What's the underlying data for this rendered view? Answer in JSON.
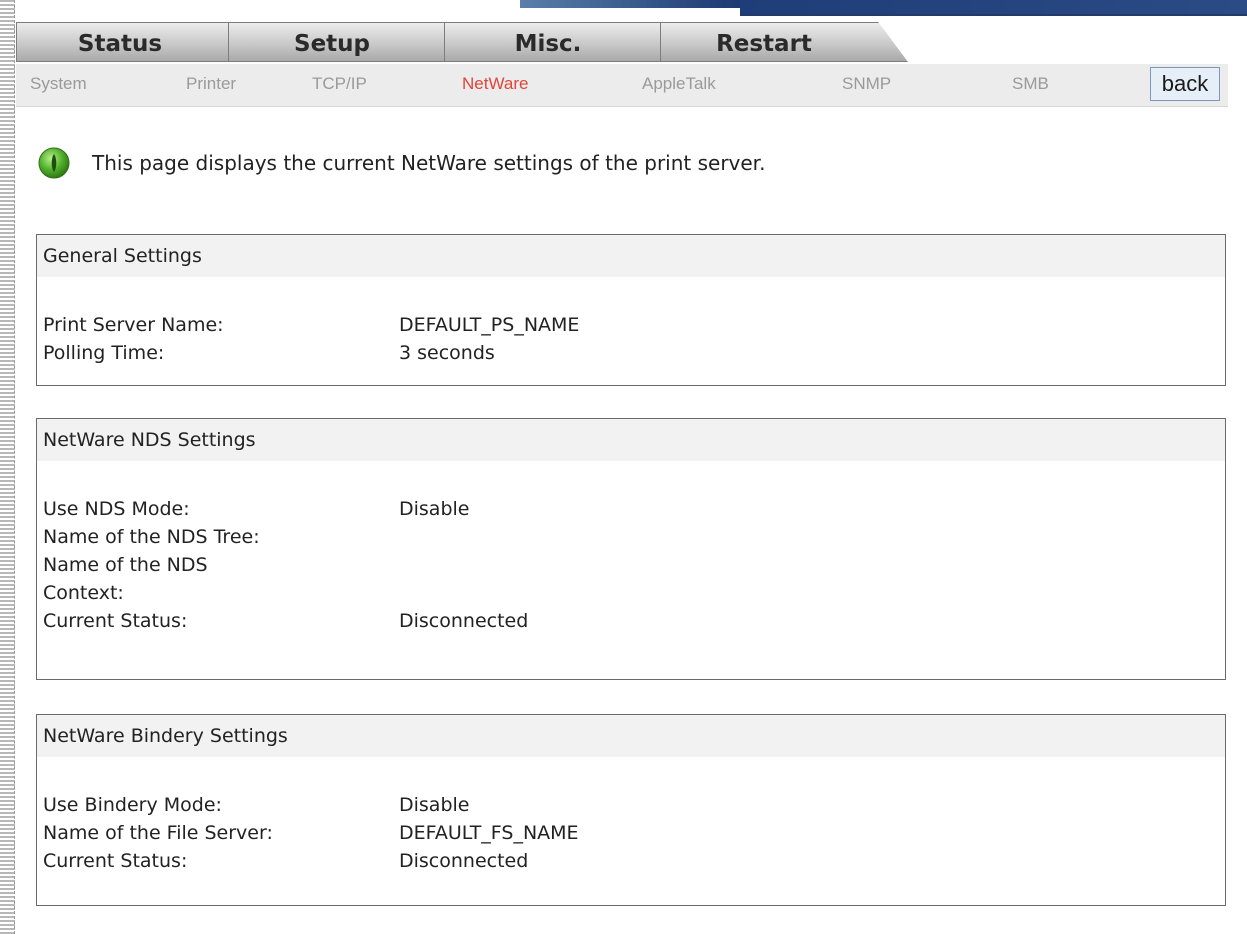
{
  "main_tabs": [
    {
      "label": "Status"
    },
    {
      "label": "Setup"
    },
    {
      "label": "Misc."
    },
    {
      "label": "Restart"
    }
  ],
  "sub_nav": {
    "items": [
      {
        "label": "System"
      },
      {
        "label": "Printer"
      },
      {
        "label": "TCP/IP"
      },
      {
        "label": "NetWare",
        "active": true
      },
      {
        "label": "AppleTalk"
      },
      {
        "label": "SNMP"
      },
      {
        "label": "SMB"
      }
    ],
    "back_label": "back"
  },
  "intro": {
    "icon": "green-info-icon",
    "text": "This page displays the current NetWare settings of the print server."
  },
  "general": {
    "title": "General Settings",
    "rows": [
      {
        "label": "Print Server Name:",
        "value": "DEFAULT_PS_NAME"
      },
      {
        "label": "Polling Time:",
        "value": "3 seconds"
      }
    ]
  },
  "nds": {
    "title": "NetWare NDS Settings",
    "rows": [
      {
        "label": "Use NDS Mode:",
        "value": "Disable"
      },
      {
        "label": "Name of the NDS Tree:",
        "value": ""
      },
      {
        "label": "Name of the NDS Context:",
        "value": ""
      },
      {
        "label": "Current Status:",
        "value": "Disconnected"
      }
    ]
  },
  "bindery": {
    "title": "NetWare Bindery Settings",
    "rows": [
      {
        "label": "Use Bindery Mode:",
        "value": "Disable"
      },
      {
        "label": "Name of the File Server:",
        "value": "DEFAULT_FS_NAME"
      },
      {
        "label": "Current Status:",
        "value": "Disconnected"
      }
    ]
  },
  "colors": {
    "active_sub_nav": "#e0463a",
    "inactive_sub_nav": "#9a9a9a",
    "panel_header_bg": "#f2f2f2"
  }
}
